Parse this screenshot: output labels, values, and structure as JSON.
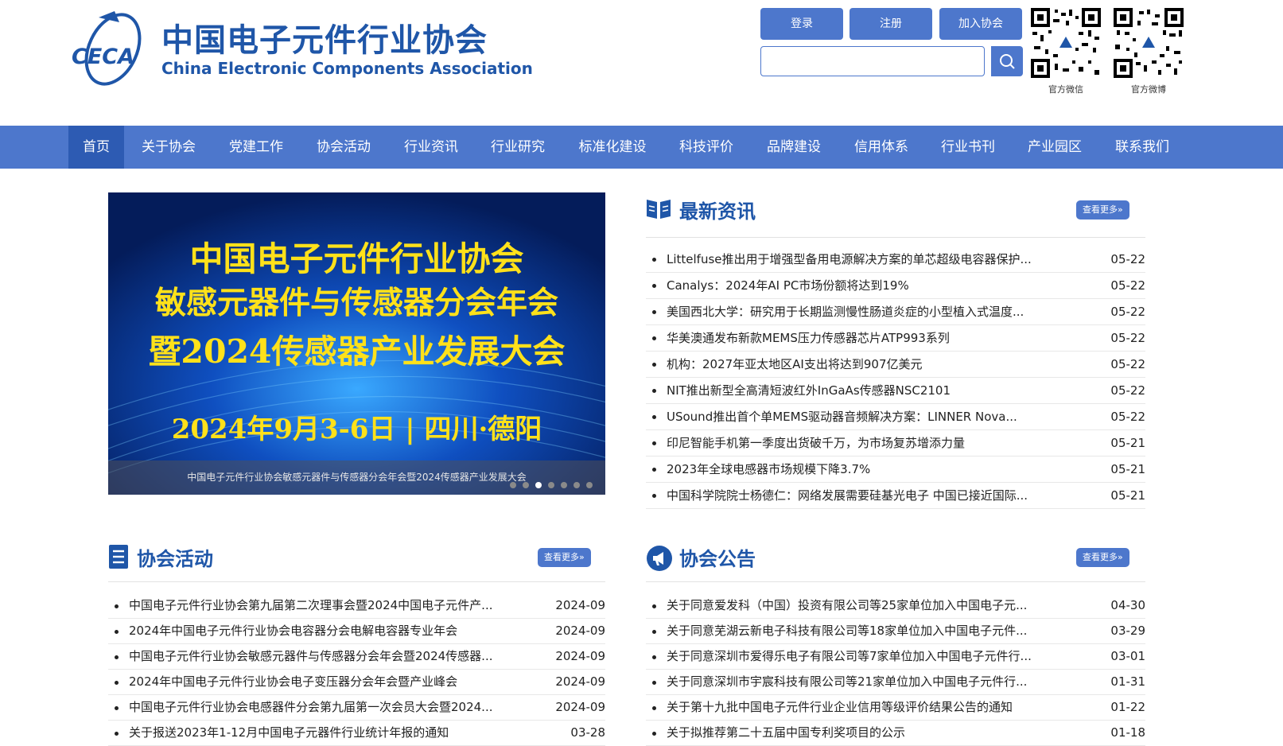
{
  "header": {
    "logo_acronym": "CECA",
    "org_name_cn": "中国电子元件行业协会",
    "org_name_en": "China Electronic Components Association",
    "buttons": {
      "login": "登录",
      "register": "注册",
      "join": "加入协会"
    },
    "search": {
      "placeholder": "",
      "icon": "search-icon"
    },
    "qr_codes": [
      {
        "label": "官方微信"
      },
      {
        "label": "官方微博"
      }
    ]
  },
  "nav": {
    "items": [
      {
        "label": "首页",
        "active": true
      },
      {
        "label": "关于协会"
      },
      {
        "label": "党建工作"
      },
      {
        "label": "协会活动"
      },
      {
        "label": "行业资讯"
      },
      {
        "label": "行业研究"
      },
      {
        "label": "标准化建设"
      },
      {
        "label": "科技评价"
      },
      {
        "label": "品牌建设"
      },
      {
        "label": "信用体系"
      },
      {
        "label": "行业书刊"
      },
      {
        "label": "产业园区"
      },
      {
        "label": "联系我们"
      }
    ]
  },
  "slider": {
    "line1": "中国电子元件行业协会",
    "line2": "敏感元器件与传感器分会年会",
    "line3": "暨2024传感器产业发展大会",
    "line4": "2024年9月3-6日 | 四川·德阳",
    "caption": "中国电子元件行业协会敏感元器件与传感器分会年会暨2024传感器产业发展大会",
    "active_dot": 3,
    "dot_count": 7
  },
  "news": {
    "title": "最新资讯",
    "more": "查看更多»",
    "icon": "book-icon",
    "items": [
      {
        "title": "Littelfuse推出用于增强型备用电源解决方案的单芯超级电容器保护...",
        "date": "05-22"
      },
      {
        "title": "Canalys：2024年AI PC市场份额将达到19%",
        "date": "05-22"
      },
      {
        "title": "美国西北大学：研究用于长期监测慢性肠道炎症的小型植入式温度...",
        "date": "05-22"
      },
      {
        "title": "华美澳通发布新款MEMS压力传感器芯片ATP993系列",
        "date": "05-22"
      },
      {
        "title": "机构：2027年亚太地区AI支出将达到907亿美元",
        "date": "05-22"
      },
      {
        "title": "NIT推出新型全高清短波红外InGaAs传感器NSC2101",
        "date": "05-22"
      },
      {
        "title": "USound推出首个单MEMS驱动器音频解决方案：LINNER Nova...",
        "date": "05-22"
      },
      {
        "title": "印尼智能手机第一季度出货破千万，为市场复苏增添力量",
        "date": "05-21"
      },
      {
        "title": "2023年全球电感器市场规模下降3.7%",
        "date": "05-21"
      },
      {
        "title": "中国科学院院士杨德仁：网络发展需要硅基光电子 中国已接近国际...",
        "date": "05-21"
      }
    ]
  },
  "activities": {
    "title": "协会活动",
    "more": "查看更多»",
    "icon": "list-doc-icon",
    "items": [
      {
        "title": "中国电子元件行业协会第九届第二次理事会暨2024中国电子元件产...",
        "date": "2024-09"
      },
      {
        "title": "2024年中国电子元件行业协会电容器分会电解电容器专业年会",
        "date": "2024-09"
      },
      {
        "title": "中国电子元件行业协会敏感元器件与传感器分会年会暨2024传感器...",
        "date": "2024-09"
      },
      {
        "title": "2024年中国电子元件行业协会电子变压器分会年会暨产业峰会",
        "date": "2024-09"
      },
      {
        "title": "中国电子元件行业协会电感器件分会第九届第一次会员大会暨2024...",
        "date": "2024-09"
      },
      {
        "title": "关于报送2023年1-12月中国电子元器件行业统计年报的通知",
        "date": "03-28"
      }
    ]
  },
  "notices": {
    "title": "协会公告",
    "more": "查看更多»",
    "icon": "megaphone-icon",
    "items": [
      {
        "title": "关于同意爱发科（中国）投资有限公司等25家单位加入中国电子元...",
        "date": "04-30"
      },
      {
        "title": "关于同意芜湖云新电子科技有限公司等18家单位加入中国电子元件...",
        "date": "03-29"
      },
      {
        "title": "关于同意深圳市爱得乐电子有限公司等7家单位加入中国电子元件行...",
        "date": "03-01"
      },
      {
        "title": "关于同意深圳市宇宸科技有限公司等21家单位加入中国电子元件行...",
        "date": "01-31"
      },
      {
        "title": "关于第十九批中国电子元件行业企业信用等级评价结果公告的通知",
        "date": "01-22"
      },
      {
        "title": "关于拟推荐第二十五届中国专利奖项目的公示",
        "date": "01-18"
      }
    ]
  },
  "colors": {
    "brand": "#1f56a8",
    "nav_bg": "#4d77cc",
    "nav_active": "#2d5bb3",
    "slide_text": "#ffe11a"
  }
}
